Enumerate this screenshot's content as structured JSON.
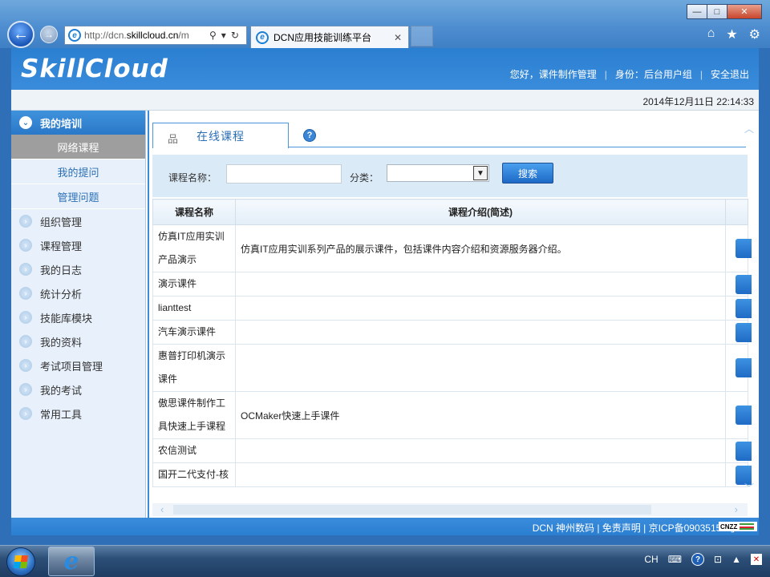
{
  "browser": {
    "window_controls": {
      "minimize": "—",
      "maximize": "□",
      "close": "✕"
    },
    "back_glyph": "←",
    "forward_glyph": "→",
    "address_prefix": "http://dcn.",
    "address_domain": "skillcloud.cn",
    "address_suffix": "/m",
    "tab_title": "DCN应用技能训练平台",
    "tab_close": "✕",
    "icons": [
      "home-icon",
      "favorites-star-icon",
      "tools-gear-icon"
    ],
    "home_glyph": "⌂",
    "star_glyph": "★",
    "gear_glyph": "⚙",
    "search_glyph": "⚲",
    "dropdown_glyph": "▾",
    "refresh_glyph": "↻"
  },
  "header": {
    "logo": "SkillCloud",
    "greeting": "您好，课件制作管理",
    "identity": "身份：后台用户组",
    "logout": "安全退出",
    "separator": "|"
  },
  "datetime": "2014年12月11日 22:14:33",
  "sidebar": {
    "section_title": "我的培训",
    "section_icon": "⌄",
    "sub_items": [
      {
        "label": "网络课程",
        "active": true
      },
      {
        "label": "我的提问",
        "active": false
      },
      {
        "label": "管理问题",
        "active": false
      }
    ],
    "item_icon": "›",
    "items": [
      "组织管理",
      "课程管理",
      "我的日志",
      "统计分析",
      "技能库模块",
      "我的资料",
      "考试项目管理",
      "我的考试",
      "常用工具"
    ]
  },
  "content": {
    "tab_label": "在线课程",
    "tab_icon": "品",
    "help_glyph": "?",
    "scroll_up_glyph": "︿",
    "scroll_down_glyph": "﹀",
    "search": {
      "name_label": "课程名称：",
      "name_value": "",
      "category_label": "分类：",
      "category_value": "",
      "dropdown_glyph": "▼",
      "button_label": "搜索"
    },
    "table": {
      "columns": [
        "课程名称",
        "课程介绍(简述)",
        ""
      ],
      "rows": [
        {
          "name": "仿真IT应用实训产品演示",
          "intro": "仿真IT应用实训系列产品的展示课件，包括课件内容介绍和资源服务器介绍。"
        },
        {
          "name": "演示课件",
          "intro": ""
        },
        {
          "name": "lianttest",
          "intro": ""
        },
        {
          "name": "汽车演示课件",
          "intro": ""
        },
        {
          "name": "惠普打印机演示课件",
          "intro": ""
        },
        {
          "name": "傲思课件制作工具快速上手课程",
          "intro": "OCMaker快速上手课件"
        },
        {
          "name": "农信测试",
          "intro": ""
        },
        {
          "name": "国开二代支付-核",
          "intro": ""
        }
      ]
    },
    "hscroll_left": "‹",
    "hscroll_right": "›"
  },
  "footer": {
    "text": "DCN 神州数码 | 免责声明 | 京ICP备09035151号",
    "badge": "CNZZ"
  },
  "taskbar": {
    "ie_glyph": "e",
    "tray": {
      "lang": "CH",
      "keyboard": "⌨",
      "help": "?",
      "network": "⊡",
      "arrow": "▲",
      "flag": "✕"
    }
  }
}
